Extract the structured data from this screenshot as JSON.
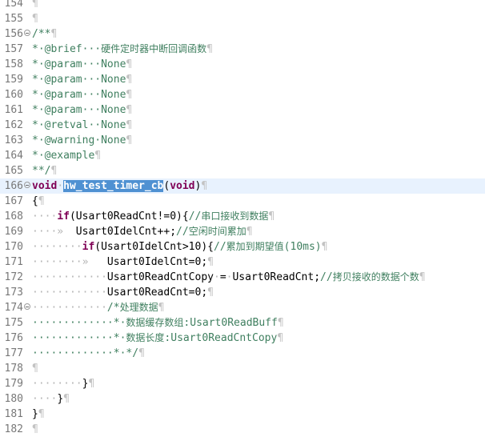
{
  "editor": {
    "colors": {
      "background": "#ffffff",
      "line_number": "#787878",
      "comment": "#3f7f5f",
      "keyword": "#7f0055",
      "selection": "#4f91d2",
      "current_line": "#e8f2fe",
      "whitespace": "#b4b4b4"
    },
    "lines": [
      {
        "num": "154",
        "fold": false,
        "current": false,
        "tokens": [
          {
            "t": "¶",
            "c": "pil"
          }
        ]
      },
      {
        "num": "155",
        "fold": false,
        "current": false,
        "tokens": [
          {
            "t": "¶",
            "c": "pil"
          }
        ]
      },
      {
        "num": "156",
        "fold": true,
        "current": false,
        "tokens": [
          {
            "t": "/**",
            "c": "cmt"
          },
          {
            "t": "¶",
            "c": "pil"
          }
        ]
      },
      {
        "num": "157",
        "fold": false,
        "current": false,
        "tokens": [
          {
            "t": "*·@brief···",
            "c": "cmt"
          },
          {
            "t": "硬件定时器中断回调函数",
            "c": "cmt cjk"
          },
          {
            "t": "¶",
            "c": "pil"
          }
        ]
      },
      {
        "num": "158",
        "fold": false,
        "current": false,
        "tokens": [
          {
            "t": "*·@param···None",
            "c": "cmt"
          },
          {
            "t": "¶",
            "c": "pil"
          }
        ]
      },
      {
        "num": "159",
        "fold": false,
        "current": false,
        "tokens": [
          {
            "t": "*·@param···None",
            "c": "cmt"
          },
          {
            "t": "¶",
            "c": "pil"
          }
        ]
      },
      {
        "num": "160",
        "fold": false,
        "current": false,
        "tokens": [
          {
            "t": "*·@param···None",
            "c": "cmt"
          },
          {
            "t": "¶",
            "c": "pil"
          }
        ]
      },
      {
        "num": "161",
        "fold": false,
        "current": false,
        "tokens": [
          {
            "t": "*·@param···None",
            "c": "cmt"
          },
          {
            "t": "¶",
            "c": "pil"
          }
        ]
      },
      {
        "num": "162",
        "fold": false,
        "current": false,
        "tokens": [
          {
            "t": "*·@retval··None",
            "c": "cmt"
          },
          {
            "t": "¶",
            "c": "pil"
          }
        ]
      },
      {
        "num": "163",
        "fold": false,
        "current": false,
        "tokens": [
          {
            "t": "*·@warning·None",
            "c": "cmt"
          },
          {
            "t": "¶",
            "c": "pil"
          }
        ]
      },
      {
        "num": "164",
        "fold": false,
        "current": false,
        "tokens": [
          {
            "t": "*·@example",
            "c": "cmt"
          },
          {
            "t": "¶",
            "c": "pil"
          }
        ]
      },
      {
        "num": "165",
        "fold": false,
        "current": false,
        "tokens": [
          {
            "t": "**/",
            "c": "cmt"
          },
          {
            "t": "¶",
            "c": "pil"
          }
        ]
      },
      {
        "num": "166",
        "fold": true,
        "current": true,
        "tokens": [
          {
            "t": "void",
            "c": "kw"
          },
          {
            "t": "·",
            "c": "ws"
          },
          {
            "t": "hw_test_timer_cb",
            "c": "fn sel"
          },
          {
            "t": "(",
            "c": ""
          },
          {
            "t": "void",
            "c": "kw"
          },
          {
            "t": ")",
            "c": ""
          },
          {
            "t": "¶",
            "c": "pil"
          }
        ]
      },
      {
        "num": "167",
        "fold": false,
        "current": false,
        "tokens": [
          {
            "t": "{",
            "c": ""
          },
          {
            "t": "¶",
            "c": "pil"
          }
        ]
      },
      {
        "num": "168",
        "fold": false,
        "current": false,
        "tokens": [
          {
            "t": "····",
            "c": "ws"
          },
          {
            "t": "if",
            "c": "kw"
          },
          {
            "t": "(Usart0ReadCnt!=0){",
            "c": ""
          },
          {
            "t": "//",
            "c": "cmt"
          },
          {
            "t": "串口接收到数据",
            "c": "cmt cjk"
          },
          {
            "t": "¶",
            "c": "pil"
          }
        ]
      },
      {
        "num": "169",
        "fold": false,
        "current": false,
        "tokens": [
          {
            "t": "····»  ",
            "c": "ws"
          },
          {
            "t": "Usart0IdelCnt++;",
            "c": ""
          },
          {
            "t": "//",
            "c": "cmt"
          },
          {
            "t": "空闲时间累加",
            "c": "cmt cjk"
          },
          {
            "t": "¶",
            "c": "pil"
          }
        ]
      },
      {
        "num": "170",
        "fold": false,
        "current": false,
        "tokens": [
          {
            "t": "········",
            "c": "ws"
          },
          {
            "t": "if",
            "c": "kw"
          },
          {
            "t": "(Usart0IdelCnt>10){",
            "c": ""
          },
          {
            "t": "//",
            "c": "cmt"
          },
          {
            "t": "累加到期望值",
            "c": "cmt cjk"
          },
          {
            "t": "(10ms)",
            "c": "cmt"
          },
          {
            "t": "¶",
            "c": "pil"
          }
        ]
      },
      {
        "num": "171",
        "fold": false,
        "current": false,
        "tokens": [
          {
            "t": "········»   ",
            "c": "ws"
          },
          {
            "t": "Usart0IdelCnt=0;",
            "c": ""
          },
          {
            "t": "¶",
            "c": "pil"
          }
        ]
      },
      {
        "num": "172",
        "fold": false,
        "current": false,
        "tokens": [
          {
            "t": "············",
            "c": "ws"
          },
          {
            "t": "Usart0ReadCntCopy",
            "c": ""
          },
          {
            "t": "·",
            "c": "ws"
          },
          {
            "t": "=",
            "c": ""
          },
          {
            "t": "·",
            "c": "ws"
          },
          {
            "t": "Usart0ReadCnt;",
            "c": ""
          },
          {
            "t": "//",
            "c": "cmt"
          },
          {
            "t": "拷贝接收的数据个数",
            "c": "cmt cjk"
          },
          {
            "t": "¶",
            "c": "pil"
          }
        ]
      },
      {
        "num": "173",
        "fold": false,
        "current": false,
        "tokens": [
          {
            "t": "············",
            "c": "ws"
          },
          {
            "t": "Usart0ReadCnt=0;",
            "c": ""
          },
          {
            "t": "¶",
            "c": "pil"
          }
        ]
      },
      {
        "num": "174",
        "fold": true,
        "current": false,
        "tokens": [
          {
            "t": "············",
            "c": "ws"
          },
          {
            "t": "/*",
            "c": "cmt"
          },
          {
            "t": "处理数据",
            "c": "cmt cjk"
          },
          {
            "t": "¶",
            "c": "pil"
          }
        ]
      },
      {
        "num": "175",
        "fold": false,
        "current": false,
        "tokens": [
          {
            "t": "·············*·",
            "c": "cmt"
          },
          {
            "t": "数据缓存数组",
            "c": "cmt cjk"
          },
          {
            "t": ":Usart0ReadBuff",
            "c": "cmt"
          },
          {
            "t": "¶",
            "c": "pil"
          }
        ]
      },
      {
        "num": "176",
        "fold": false,
        "current": false,
        "tokens": [
          {
            "t": "·············*·",
            "c": "cmt"
          },
          {
            "t": "数据长度",
            "c": "cmt cjk"
          },
          {
            "t": ":Usart0ReadCntCopy",
            "c": "cmt"
          },
          {
            "t": "¶",
            "c": "pil"
          }
        ]
      },
      {
        "num": "177",
        "fold": false,
        "current": false,
        "tokens": [
          {
            "t": "·············*·*/",
            "c": "cmt"
          },
          {
            "t": "¶",
            "c": "pil"
          }
        ]
      },
      {
        "num": "178",
        "fold": false,
        "current": false,
        "tokens": [
          {
            "t": "¶",
            "c": "pil"
          }
        ]
      },
      {
        "num": "179",
        "fold": false,
        "current": false,
        "tokens": [
          {
            "t": "········",
            "c": "ws"
          },
          {
            "t": "}",
            "c": ""
          },
          {
            "t": "¶",
            "c": "pil"
          }
        ]
      },
      {
        "num": "180",
        "fold": false,
        "current": false,
        "tokens": [
          {
            "t": "····",
            "c": "ws"
          },
          {
            "t": "}",
            "c": ""
          },
          {
            "t": "¶",
            "c": "pil"
          }
        ]
      },
      {
        "num": "181",
        "fold": false,
        "current": false,
        "tokens": [
          {
            "t": "}",
            "c": ""
          },
          {
            "t": "¶",
            "c": "pil"
          }
        ]
      },
      {
        "num": "182",
        "fold": false,
        "current": false,
        "tokens": [
          {
            "t": "¶",
            "c": "pil"
          }
        ]
      }
    ]
  }
}
